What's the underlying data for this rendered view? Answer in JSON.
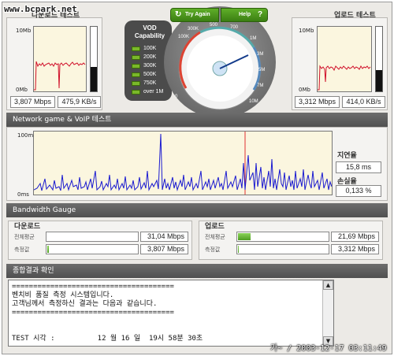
{
  "watermark": "www.bcpark.net",
  "download": {
    "title": "다운로드 테스트",
    "ymax": "10Mb",
    "ymin": "0Mb",
    "speed": "3,807 Mbps",
    "rate": "475,9 KB/s",
    "level": 0.38
  },
  "upload": {
    "title": "업로드 테스트",
    "ymax": "10Mb",
    "ymin": "0Mb",
    "speed": "3,312 Mbps",
    "rate": "414,0 KB/s",
    "level": 0.33
  },
  "vod": {
    "title1": "VOD",
    "title2": "Capability",
    "items": [
      "100K",
      "200K",
      "300K",
      "500K",
      "750K",
      "over 1M"
    ]
  },
  "gauge": {
    "try_again": "Try Again",
    "help": "Help",
    "help_icon": "?",
    "refresh_icon": "refresh-icon",
    "ticks": [
      "0",
      "100K",
      "300K",
      "400",
      "500",
      "600",
      "700",
      "800",
      "900",
      "1M",
      "3M",
      "5M",
      "7M",
      "10M"
    ],
    "needle_value": "3.8M"
  },
  "network": {
    "title": "Network game & VoIP 테스트",
    "ymax": "100m",
    "ymin": "0ms",
    "latency_label": "지연율",
    "latency": "15,8 ms",
    "loss_label": "손실율",
    "loss": "0,133 %"
  },
  "bandwidth": {
    "title": "Bandwidth Gauge",
    "download_label": "다운로드",
    "upload_label": "업로드",
    "avg_label": "전체평균",
    "measured_label": "측정값",
    "dl_avg": "31,04 Mbps",
    "dl_measured": "3,807 Mbps",
    "ul_avg": "21,69 Mbps",
    "ul_measured": "3,312 Mbps",
    "dl_avg_level": 0.0,
    "dl_measured_level": 0.02,
    "ul_avg_level": 0.12,
    "ul_measured_level": 0.01
  },
  "result": {
    "title": "종합결과 확인",
    "text": "======================================\n벤치비 품질 측정 시스템입니다.\n고객님께서 측정하신 결과는 다음과 같습니다.\n======================================\n\n\nTEST 시각 :          12 월 16 일  19시 58분 30초"
  },
  "timestamp": "가~ / 2003-12-17 03:11:49",
  "colors": {
    "accent_green": "#4f9d22",
    "graph_bg": "#fbf6df",
    "download_line": "#d0102a",
    "network_line": "#1a1ad0",
    "dark_bar": "#505050"
  }
}
